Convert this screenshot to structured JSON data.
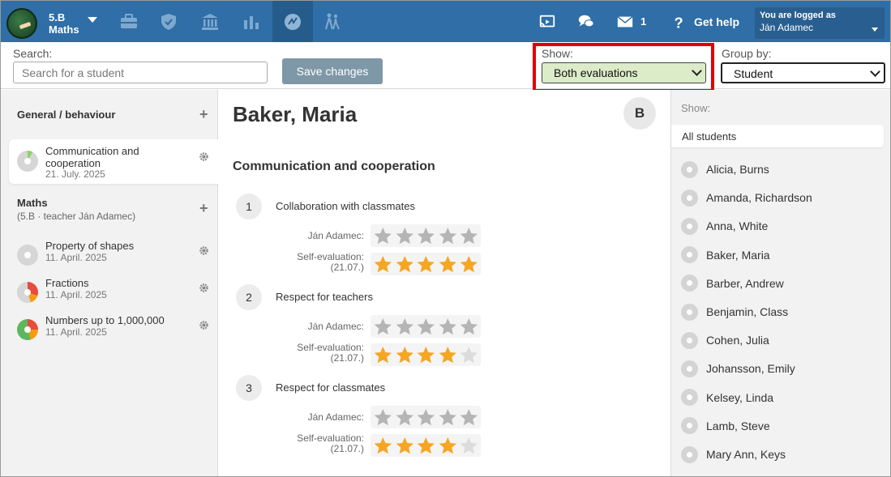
{
  "header": {
    "class_line1": "5.B",
    "class_line2": "Maths",
    "nav_icons": [
      "briefcase-icon",
      "shield-check-icon",
      "institution-icon",
      "bar-chart-icon",
      "evaluation-icon",
      "students-walking-icon"
    ],
    "cast_icon": "cast-icon",
    "chat_icon": "chat-icon",
    "mail_count": "1",
    "help_label": "Get help",
    "user_logged_label": "You are logged as",
    "user_name": "Ján Adamec"
  },
  "filters": {
    "search_label": "Search:",
    "search_placeholder": "Search for a student",
    "save_label": "Save changes",
    "show_label": "Show:",
    "show_value": "Both evaluations",
    "group_label": "Group by:",
    "group_value": "Student"
  },
  "left": {
    "groups": [
      {
        "title": "General / behaviour",
        "subtitle": "",
        "lessons": [
          {
            "name": "Communication and cooperation",
            "date": "21. July. 2025",
            "active": true
          }
        ]
      },
      {
        "title": "Maths",
        "subtitle": "(5.B · teacher Ján Adamec)",
        "lessons": [
          {
            "name": "Property of shapes",
            "date": "11. April. 2025",
            "active": false
          },
          {
            "name": "Fractions",
            "date": "11. April. 2025",
            "active": false
          },
          {
            "name": "Numbers up to 1,000,000",
            "date": "11. April. 2025",
            "active": false
          }
        ]
      }
    ]
  },
  "center": {
    "student_name": "Baker, Maria",
    "badge": "B",
    "section_title": "Communication and cooperation",
    "criteria": [
      {
        "num": "1",
        "name": "Collaboration with classmates",
        "teacher_label": "Ján Adamec:",
        "teacher_stars": 0,
        "self_label": "Self-evaluation:",
        "self_date": "(21.07.)",
        "self_stars": 5
      },
      {
        "num": "2",
        "name": "Respect for teachers",
        "teacher_label": "Ján Adamec:",
        "teacher_stars": 0,
        "self_label": "Self-evaluation:",
        "self_date": "(21.07.)",
        "self_stars": 4
      },
      {
        "num": "3",
        "name": "Respect for classmates",
        "teacher_label": "Ján Adamec:",
        "teacher_stars": 0,
        "self_label": "Self-evaluation:",
        "self_date": "(21.07.)",
        "self_stars": 4
      }
    ],
    "star_max": 5
  },
  "right": {
    "show_label": "Show:",
    "all_students": "All students",
    "students": [
      "Alicia, Burns",
      "Amanda, Richardson",
      "Anna, White",
      "Baker, Maria",
      "Barber, Andrew",
      "Benjamin, Class",
      "Cohen, Julia",
      "Johansson, Emily",
      "Kelsey, Linda",
      "Lamb, Steve",
      "Mary Ann, Keys"
    ]
  },
  "colors": {
    "topbar": "#2f6ea6",
    "star_filled": "#f5a623",
    "star_empty": "#b5b5b5",
    "highlight_border": "#e00000",
    "show_select_bg": "#dcebc8"
  }
}
